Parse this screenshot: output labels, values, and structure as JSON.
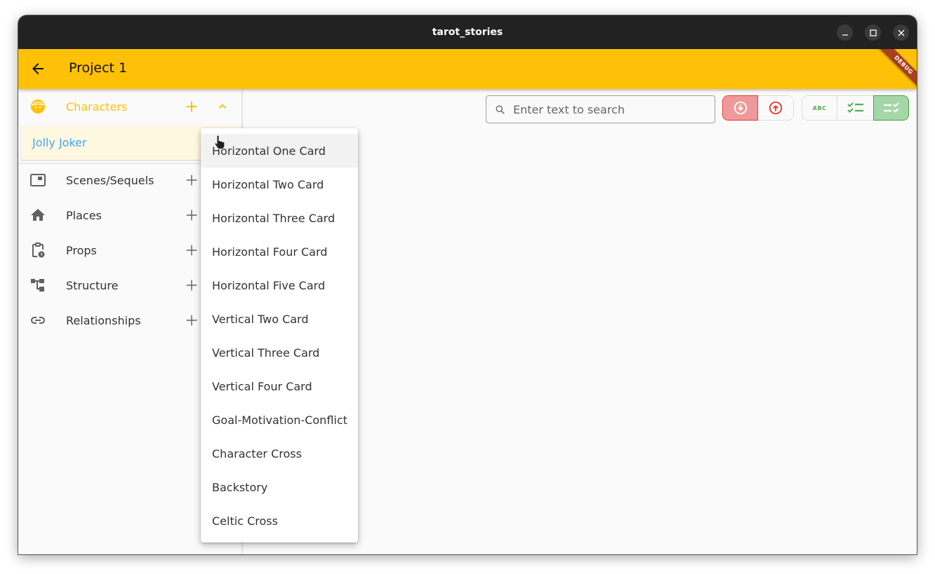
{
  "window": {
    "title": "tarot_stories",
    "controls": [
      "minimize",
      "maximize",
      "close"
    ]
  },
  "appbar": {
    "back_icon": "arrow-left-icon",
    "title": "Project 1",
    "debug_banner": "DEBUG",
    "color": "#ffc107"
  },
  "sidebar": {
    "sections": [
      {
        "label": "Characters",
        "icon": "face-icon",
        "expanded": true,
        "active": true
      },
      {
        "label": "Scenes/Sequels",
        "icon": "scene-icon"
      },
      {
        "label": "Places",
        "icon": "home-icon"
      },
      {
        "label": "Props",
        "icon": "clipboard-clock-icon"
      },
      {
        "label": "Structure",
        "icon": "structure-tree-icon"
      },
      {
        "label": "Relationships",
        "icon": "link-icon"
      }
    ],
    "characters": [
      {
        "label": "Jolly Joker"
      }
    ],
    "accent": "#ffc107",
    "child_color": "#42a5f5"
  },
  "toolbar": {
    "search_placeholder": "Enter text to search",
    "search_value": "",
    "sort_buttons": [
      {
        "name": "sort-descending",
        "selected": true
      },
      {
        "name": "sort-ascending",
        "selected": false
      }
    ],
    "view_buttons": [
      {
        "name": "alphabetic-view",
        "label": "ABC",
        "selected": false
      },
      {
        "name": "checklist-view",
        "selected": false
      },
      {
        "name": "checklist-reverse-view",
        "selected": true
      }
    ]
  },
  "dropdown_menu": {
    "items": [
      "Horizontal One Card",
      "Horizontal Two Card",
      "Horizontal Three Card",
      "Horizontal Four Card",
      "Horizontal Five Card",
      "Vertical Two Card",
      "Vertical Three Card",
      "Vertical Four Card",
      "Goal-Motivation-Conflict",
      "Character Cross",
      "Backstory",
      "Celtic Cross"
    ],
    "hovered_index": 0
  }
}
